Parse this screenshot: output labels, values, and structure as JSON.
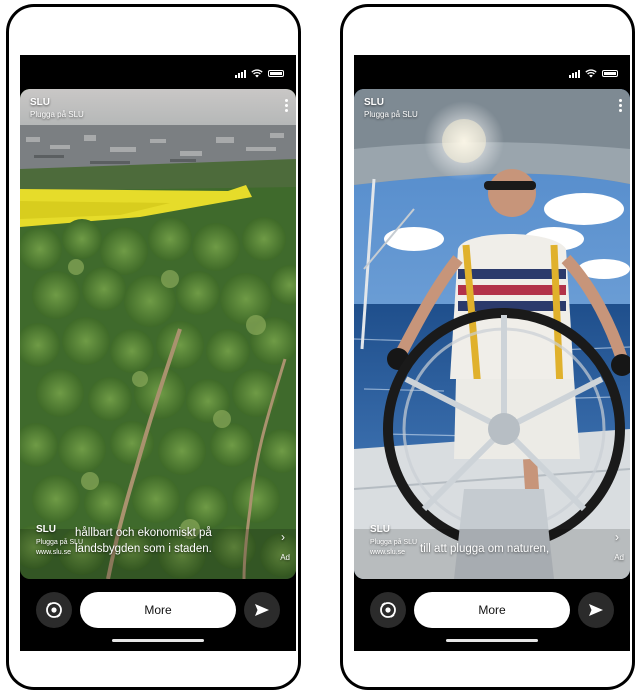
{
  "phones": [
    {
      "brand": "SLU",
      "brand_sub": "Plugga på SLU",
      "ad_name": "SLU",
      "ad_sub": "Plugga på SLU",
      "ad_url": "www.slu.se",
      "caption_line1": "hållbart och ekonomiskt på",
      "caption_line2": "landsbygden som i staden.",
      "ad_badge": "Ad",
      "more_label": "More"
    },
    {
      "brand": "SLU",
      "brand_sub": "Plugga på SLU",
      "ad_name": "SLU",
      "ad_sub": "Plugga på SLU",
      "ad_url": "www.slu.se",
      "caption_line1": "till att plugga om naturen,",
      "ad_badge": "Ad",
      "more_label": "More"
    }
  ],
  "icons": {
    "status": [
      "signal-icon",
      "wifi-icon",
      "battery-icon"
    ],
    "menu": "more-options-icon",
    "camera": "camera-flip-icon",
    "send": "send-arrow-icon",
    "chevron": "chevron-right-icon"
  }
}
